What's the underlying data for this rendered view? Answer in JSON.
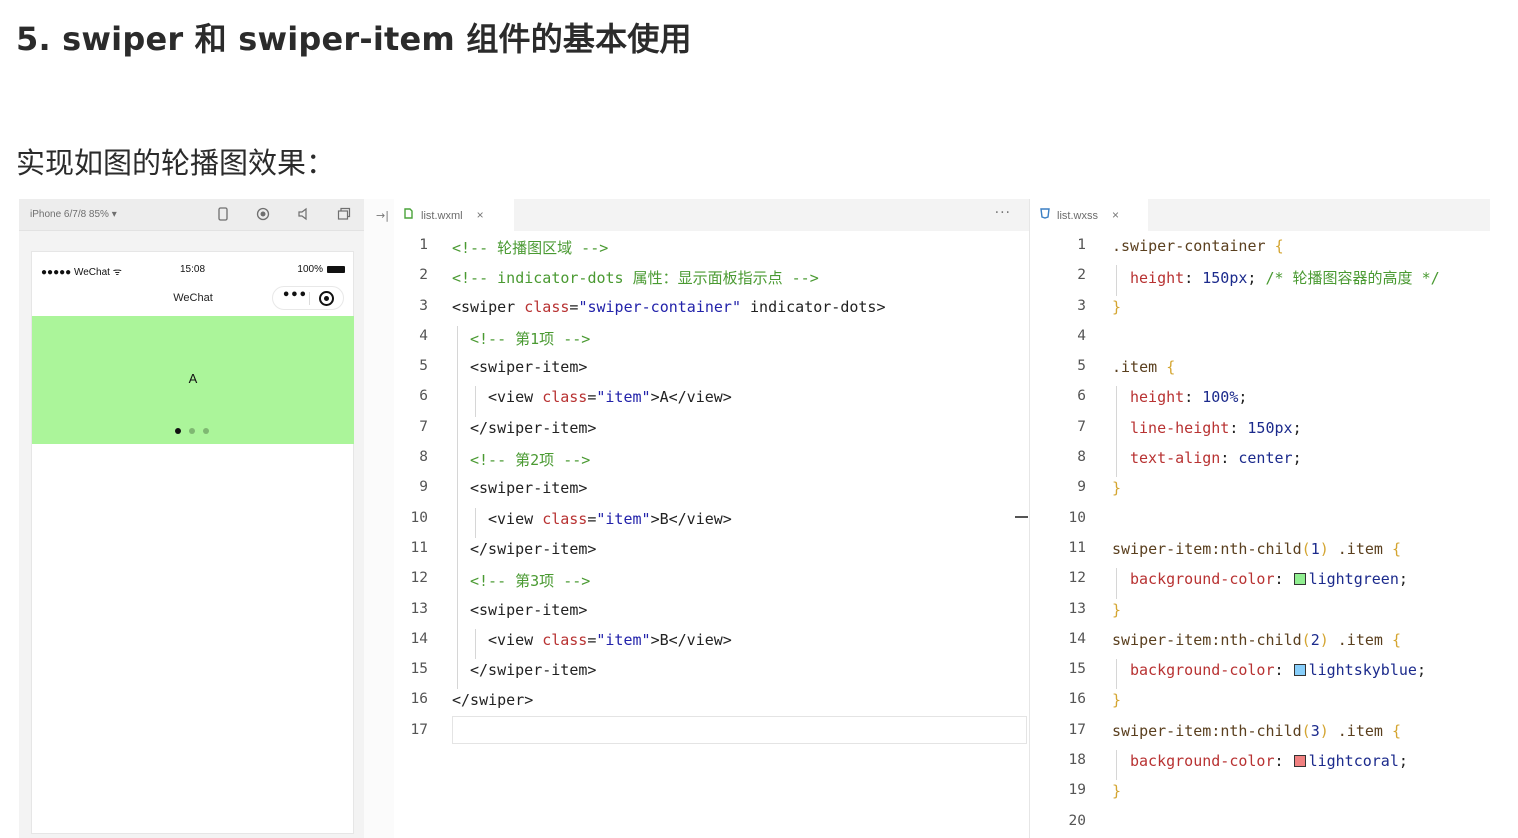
{
  "page": {
    "title": "5. swiper 和 swiper-item 组件的基本使用",
    "subtitle": "实现如图的轮播图效果："
  },
  "simulator": {
    "device": "iPhone 6/7/8 85% ▾",
    "status_left": "●●●●● WeChat ᯤ",
    "status_time": "15:08",
    "status_battery": "100%",
    "nav_title": "WeChat",
    "capsule_dots": "•••",
    "swiper_text": "A",
    "swiper_color": "#abf59a",
    "dot_active_color": "#111111",
    "dot_inactive_color": "#7fb872",
    "toolbar_icons": [
      "phone-icon",
      "record-icon",
      "speaker-icon",
      "window-icon",
      "dock-icon"
    ]
  },
  "wxml_editor": {
    "tab_label": "list.wxml",
    "tab_icon_color": "#4aa33a",
    "more": "···",
    "lines": [
      {
        "n": "1",
        "indent": 0,
        "parts": [
          [
            "cm",
            "<!-- 轮播图区域 -->"
          ]
        ]
      },
      {
        "n": "2",
        "indent": 0,
        "parts": [
          [
            "cm",
            "<!-- indicator-dots 属性：显示面板指示点 -->"
          ]
        ]
      },
      {
        "n": "3",
        "indent": 0,
        "parts": [
          [
            "tg",
            "<swiper "
          ],
          [
            "at",
            "class"
          ],
          [
            "tg",
            "="
          ],
          [
            "st",
            "\"swiper-container\""
          ],
          [
            "tg",
            " indicator-dots>"
          ]
        ]
      },
      {
        "n": "4",
        "indent": 1,
        "parts": [
          [
            "cm",
            "<!-- 第1项 -->"
          ]
        ]
      },
      {
        "n": "5",
        "indent": 1,
        "parts": [
          [
            "tg",
            "<swiper-item>"
          ]
        ]
      },
      {
        "n": "6",
        "indent": 2,
        "parts": [
          [
            "tg",
            "<view "
          ],
          [
            "at",
            "class"
          ],
          [
            "tg",
            "="
          ],
          [
            "st",
            "\"item\""
          ],
          [
            "tg",
            ">A</view>"
          ]
        ]
      },
      {
        "n": "7",
        "indent": 1,
        "parts": [
          [
            "tg",
            "</swiper-item>"
          ]
        ]
      },
      {
        "n": "8",
        "indent": 1,
        "parts": [
          [
            "cm",
            "<!-- 第2项 -->"
          ]
        ]
      },
      {
        "n": "9",
        "indent": 1,
        "parts": [
          [
            "tg",
            "<swiper-item>"
          ]
        ]
      },
      {
        "n": "10",
        "indent": 2,
        "parts": [
          [
            "tg",
            "<view "
          ],
          [
            "at",
            "class"
          ],
          [
            "tg",
            "="
          ],
          [
            "st",
            "\"item\""
          ],
          [
            "tg",
            ">B</view>"
          ]
        ]
      },
      {
        "n": "11",
        "indent": 1,
        "parts": [
          [
            "tg",
            "</swiper-item>"
          ]
        ]
      },
      {
        "n": "12",
        "indent": 1,
        "parts": [
          [
            "cm",
            "<!-- 第3项 -->"
          ]
        ]
      },
      {
        "n": "13",
        "indent": 1,
        "parts": [
          [
            "tg",
            "<swiper-item>"
          ]
        ]
      },
      {
        "n": "14",
        "indent": 2,
        "parts": [
          [
            "tg",
            "<view "
          ],
          [
            "at",
            "class"
          ],
          [
            "tg",
            "="
          ],
          [
            "st",
            "\"item\""
          ],
          [
            "tg",
            ">B</view>"
          ]
        ]
      },
      {
        "n": "15",
        "indent": 1,
        "parts": [
          [
            "tg",
            "</swiper-item>"
          ]
        ]
      },
      {
        "n": "16",
        "indent": 0,
        "parts": [
          [
            "tg",
            "</swiper>"
          ]
        ]
      },
      {
        "n": "17",
        "indent": 0,
        "parts": []
      }
    ]
  },
  "wxss_editor": {
    "tab_label": "list.wxss",
    "tab_icon_color": "#3a7fc4",
    "lines": [
      {
        "n": "1",
        "indent": 0,
        "parts": [
          [
            "sel",
            ".swiper-container "
          ],
          [
            "br",
            "{"
          ]
        ]
      },
      {
        "n": "2",
        "indent": 1,
        "parts": [
          [
            "pr",
            "height"
          ],
          [
            "tg",
            ": "
          ],
          [
            "vl",
            "150px"
          ],
          [
            "tg",
            "; "
          ],
          [
            "cm",
            "/* 轮播图容器的高度 */"
          ]
        ]
      },
      {
        "n": "3",
        "indent": 0,
        "parts": [
          [
            "br",
            "}"
          ]
        ]
      },
      {
        "n": "4",
        "indent": 0,
        "parts": []
      },
      {
        "n": "5",
        "indent": 0,
        "parts": [
          [
            "sel",
            ".item "
          ],
          [
            "br",
            "{"
          ]
        ]
      },
      {
        "n": "6",
        "indent": 1,
        "parts": [
          [
            "pr",
            "height"
          ],
          [
            "tg",
            ": "
          ],
          [
            "vl",
            "100%"
          ],
          [
            "tg",
            ";"
          ]
        ]
      },
      {
        "n": "7",
        "indent": 1,
        "parts": [
          [
            "pr",
            "line-height"
          ],
          [
            "tg",
            ": "
          ],
          [
            "vl",
            "150px"
          ],
          [
            "tg",
            ";"
          ]
        ]
      },
      {
        "n": "8",
        "indent": 1,
        "parts": [
          [
            "pr",
            "text-align"
          ],
          [
            "tg",
            ": "
          ],
          [
            "vl",
            "center"
          ],
          [
            "tg",
            ";"
          ]
        ]
      },
      {
        "n": "9",
        "indent": 0,
        "parts": [
          [
            "br",
            "}"
          ]
        ]
      },
      {
        "n": "10",
        "indent": 0,
        "parts": []
      },
      {
        "n": "11",
        "indent": 0,
        "parts": [
          [
            "sel",
            "swiper-item:nth-child"
          ],
          [
            "br",
            "("
          ],
          [
            "vl",
            "1"
          ],
          [
            "br",
            ")"
          ],
          [
            "sel",
            " .item "
          ],
          [
            "br",
            "{"
          ]
        ]
      },
      {
        "n": "12",
        "indent": 1,
        "parts": [
          [
            "pr",
            "background-color"
          ],
          [
            "tg",
            ": "
          ],
          [
            "swatch",
            "#90ee90"
          ],
          [
            "vl",
            "lightgreen"
          ],
          [
            "tg",
            ";"
          ]
        ]
      },
      {
        "n": "13",
        "indent": 0,
        "parts": [
          [
            "br",
            "}"
          ]
        ]
      },
      {
        "n": "14",
        "indent": 0,
        "parts": [
          [
            "sel",
            "swiper-item:nth-child"
          ],
          [
            "br",
            "("
          ],
          [
            "vl",
            "2"
          ],
          [
            "br",
            ")"
          ],
          [
            "sel",
            " .item "
          ],
          [
            "br",
            "{"
          ]
        ]
      },
      {
        "n": "15",
        "indent": 1,
        "parts": [
          [
            "pr",
            "background-color"
          ],
          [
            "tg",
            ": "
          ],
          [
            "swatch",
            "#87cefa"
          ],
          [
            "vl",
            "lightskyblue"
          ],
          [
            "tg",
            ";"
          ]
        ]
      },
      {
        "n": "16",
        "indent": 0,
        "parts": [
          [
            "br",
            "}"
          ]
        ]
      },
      {
        "n": "17",
        "indent": 0,
        "parts": [
          [
            "sel",
            "swiper-item:nth-child"
          ],
          [
            "br",
            "("
          ],
          [
            "vl",
            "3"
          ],
          [
            "br",
            ")"
          ],
          [
            "sel",
            " .item "
          ],
          [
            "br",
            "{"
          ]
        ]
      },
      {
        "n": "18",
        "indent": 1,
        "parts": [
          [
            "pr",
            "background-color"
          ],
          [
            "tg",
            ": "
          ],
          [
            "swatch",
            "#f08080"
          ],
          [
            "vl",
            "lightcoral"
          ],
          [
            "tg",
            ";"
          ]
        ]
      },
      {
        "n": "19",
        "indent": 0,
        "parts": [
          [
            "br",
            "}"
          ]
        ]
      },
      {
        "n": "20",
        "indent": 0,
        "parts": []
      }
    ]
  }
}
